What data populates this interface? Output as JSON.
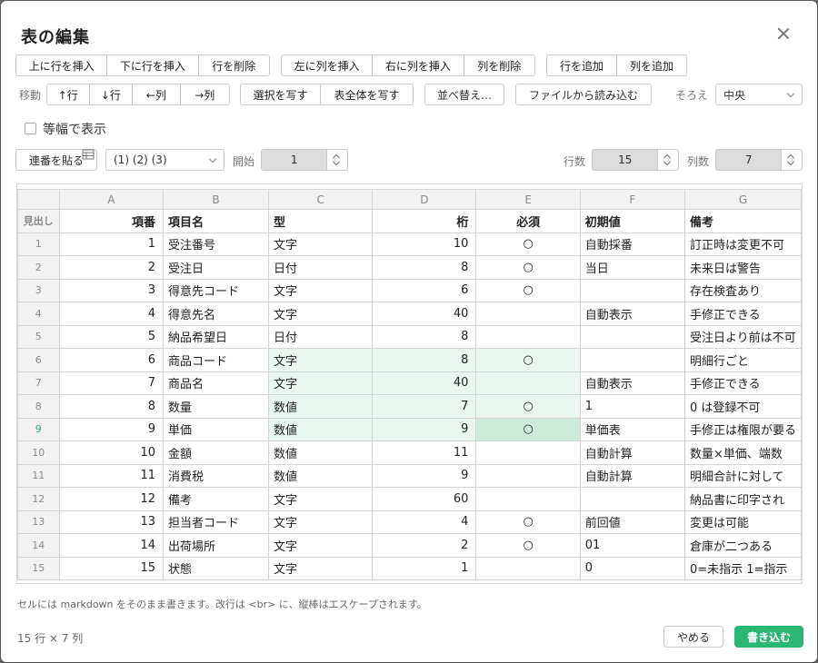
{
  "dialog": {
    "title": "表の編集",
    "close_icon": "close-icon"
  },
  "toolbar1": {
    "rows": [
      "上に行を挿入",
      "下に行を挿入",
      "行を削除"
    ],
    "cols": [
      "左に列を挿入",
      "右に列を挿入",
      "列を削除"
    ],
    "add": [
      "行を追加",
      "列を追加"
    ]
  },
  "toolbar2": {
    "move_label": "移動",
    "move": [
      "↑行",
      "↓行",
      "←列",
      "→列"
    ],
    "copy": [
      "選択を写す",
      "表全体を写す"
    ],
    "sort": "並べ替え…",
    "file": "ファイルから読み込む",
    "align_label": "そろえ",
    "align_value": "中央"
  },
  "monospace_label": "等幅で表示",
  "seq": {
    "paste_button": "連番を貼る",
    "format_value": "(1) (2) (3)",
    "start_label": "開始",
    "start_value": "1",
    "rows_label": "行数",
    "rows_value": "15",
    "cols_label": "列数",
    "cols_value": "7"
  },
  "grid": {
    "col_letters": [
      "A",
      "B",
      "C",
      "D",
      "E",
      "F",
      "G"
    ],
    "header_row_label": "見出し",
    "headers": [
      "項番",
      "項目名",
      "型",
      "桁",
      "必須",
      "初期値",
      "備考"
    ],
    "rows": [
      [
        "1",
        "受注番号",
        "文字",
        "10",
        "○",
        "自動採番",
        "訂正時は変更不可"
      ],
      [
        "2",
        "受注日",
        "日付",
        "8",
        "○",
        "当日",
        "未来日は警告"
      ],
      [
        "3",
        "得意先コード",
        "文字",
        "6",
        "○",
        "",
        "存在検査あり"
      ],
      [
        "4",
        "得意先名",
        "文字",
        "40",
        "",
        "自動表示",
        "手修正できる"
      ],
      [
        "5",
        "納品希望日",
        "日付",
        "8",
        "",
        "",
        "受注日より前は不可"
      ],
      [
        "6",
        "商品コード",
        "文字",
        "8",
        "○",
        "",
        "明細行ごと"
      ],
      [
        "7",
        "商品名",
        "文字",
        "40",
        "",
        "自動表示",
        "手修正できる"
      ],
      [
        "8",
        "数量",
        "数値",
        "7",
        "○",
        "1",
        "0 は登録不可"
      ],
      [
        "9",
        "単価",
        "数値",
        "9",
        "○",
        "単価表",
        "手修正は権限が要る"
      ],
      [
        "10",
        "金額",
        "数値",
        "11",
        "",
        "自動計算",
        "数量×単価、端数"
      ],
      [
        "11",
        "消費税",
        "数値",
        "9",
        "",
        "自動計算",
        "明細合計に対して"
      ],
      [
        "12",
        "備考",
        "文字",
        "60",
        "",
        "",
        "納品書に印字され"
      ],
      [
        "13",
        "担当者コード",
        "文字",
        "4",
        "○",
        "前回値",
        "変更は可能"
      ],
      [
        "14",
        "出荷場所",
        "文字",
        "2",
        "○",
        "01",
        "倉庫が二つある"
      ],
      [
        "15",
        "状態",
        "文字",
        "1",
        "",
        "0",
        "0=未指示 1=指示"
      ]
    ]
  },
  "footnote": "セルには markdown をそのまま書きます。改行は <br> に、縦棒はエスケープされます。",
  "footer": {
    "count": "15 行 × 7 列",
    "cancel": "やめる",
    "ok": "書き込む"
  },
  "colors": {
    "accent": "#2bb673",
    "selection": "#e9f6ef",
    "current_cell": "#cdebdb"
  }
}
